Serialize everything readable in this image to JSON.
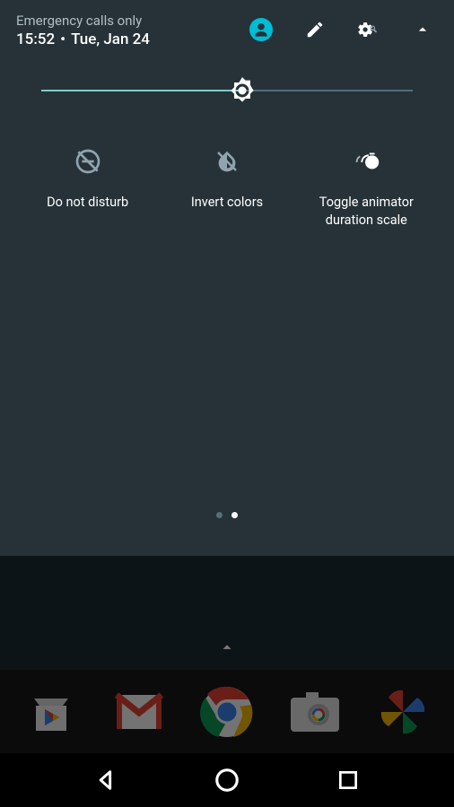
{
  "status": {
    "network": "Emergency calls only",
    "time": "15:52",
    "date": "Tue, Jan 24"
  },
  "brightness": {
    "percent": 54
  },
  "tiles": [
    {
      "label": "Do not disturb"
    },
    {
      "label": "Invert colors"
    },
    {
      "label": "Toggle animator duration scale"
    }
  ],
  "page_indicator": {
    "count": 2,
    "active": 1
  },
  "colors": {
    "accent": "#80cbc4",
    "user_bg": "#00bcd4"
  }
}
